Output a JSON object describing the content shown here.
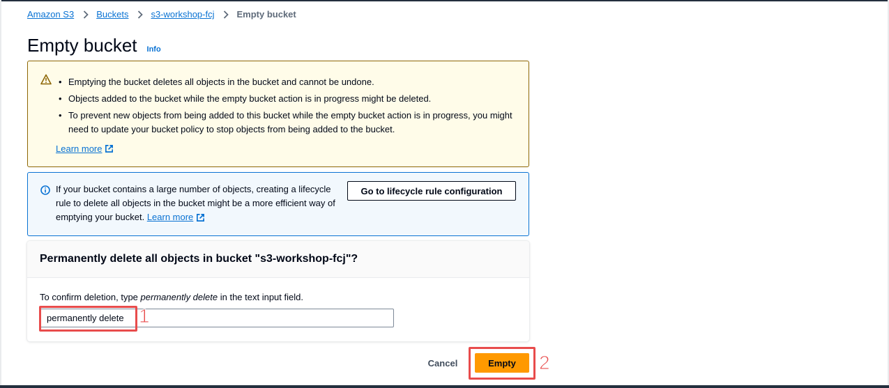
{
  "breadcrumb": {
    "items": [
      "Amazon S3",
      "Buckets",
      "s3-workshop-fcj"
    ],
    "current": "Empty bucket"
  },
  "page": {
    "title": "Empty bucket",
    "info_label": "Info"
  },
  "warning": {
    "bullets": [
      "Emptying the bucket deletes all objects in the bucket and cannot be undone.",
      "Objects added to the bucket while the empty bucket action is in progress might be deleted.",
      "To prevent new objects from being added to this bucket while the empty bucket action is in progress, you might need to update your bucket policy to stop objects from being added to the bucket."
    ],
    "learn_more": "Learn more"
  },
  "info_alert": {
    "text": "If your bucket contains a large number of objects, creating a lifecycle rule to delete all objects in the bucket might be a more efficient way of emptying your bucket.",
    "learn_more": "Learn more",
    "button_label": "Go to lifecycle rule configuration"
  },
  "confirm": {
    "title": "Permanently delete all objects in bucket \"s3-workshop-fcj\"?",
    "label_prefix": "To confirm deletion, type ",
    "label_emphasis": "permanently delete",
    "label_suffix": " in the text input field.",
    "input_value": "permanently delete"
  },
  "actions": {
    "cancel_label": "Cancel",
    "empty_label": "Empty"
  },
  "annotations": {
    "step1": "1",
    "step2": "2"
  },
  "colors": {
    "link": "#0972d3",
    "warning_bg": "#fffce9",
    "warning_border": "#8d6605",
    "info_bg": "#f2f8fd",
    "info_border": "#0972d3",
    "primary_button": "#ff9900",
    "annotation": "#e84c4c"
  }
}
